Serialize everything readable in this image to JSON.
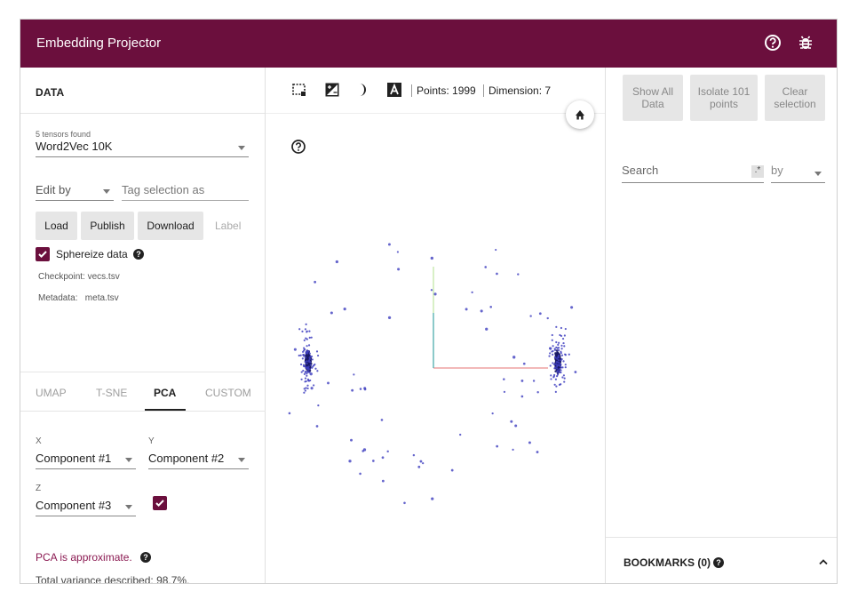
{
  "header": {
    "title": "Embedding Projector",
    "help_icon": "help-circle-icon",
    "bug_icon": "bug-icon",
    "background": "#6b0f3d"
  },
  "data_panel": {
    "heading": "DATA",
    "tensors_found": "5 tensors found",
    "tensor_selected": "Word2Vec 10K",
    "edit_by": "Edit by",
    "tag_selection_placeholder": "Tag selection as",
    "buttons": {
      "load": "Load",
      "publish": "Publish",
      "download": "Download",
      "label": "Label"
    },
    "spherize_label": "Sphereize data",
    "spherize_checked": true,
    "checkpoint": "Checkpoint: vecs.tsv",
    "metadata": "Metadata:   meta.tsv"
  },
  "projection_tabs": [
    {
      "label": "UMAP",
      "active": false
    },
    {
      "label": "T-SNE",
      "active": false
    },
    {
      "label": "PCA",
      "active": true
    },
    {
      "label": "CUSTOM",
      "active": false
    }
  ],
  "pca": {
    "x_label": "X",
    "x_value": "Component #1",
    "y_label": "Y",
    "y_value": "Component #2",
    "z_label": "Z",
    "z_value": "Component #3",
    "z_enabled": true,
    "approx_note": "PCA is approximate.",
    "variance": "Total variance described: 98.7%."
  },
  "toolbar": {
    "points": "Points: 1999",
    "dimension": "Dimension: 7",
    "icons": [
      "bounding-box-select-icon",
      "night-mode-icon",
      "moon-icon",
      "label-a-icon",
      "home-icon",
      "help-circle-icon"
    ]
  },
  "right_panel": {
    "show_all": "Show All Data",
    "isolate": "Isolate 101 points",
    "clear": "Clear selection",
    "search_placeholder": "Search",
    "regex": ".*",
    "by": "by",
    "bookmarks": "BOOKMARKS (0)"
  },
  "colors": {
    "accent": "#6b0f3d",
    "points": "#3f3fbf",
    "axis_x": "#e57373",
    "axis_y": "#b2e08c",
    "axis_z": "#3fa7a7"
  }
}
